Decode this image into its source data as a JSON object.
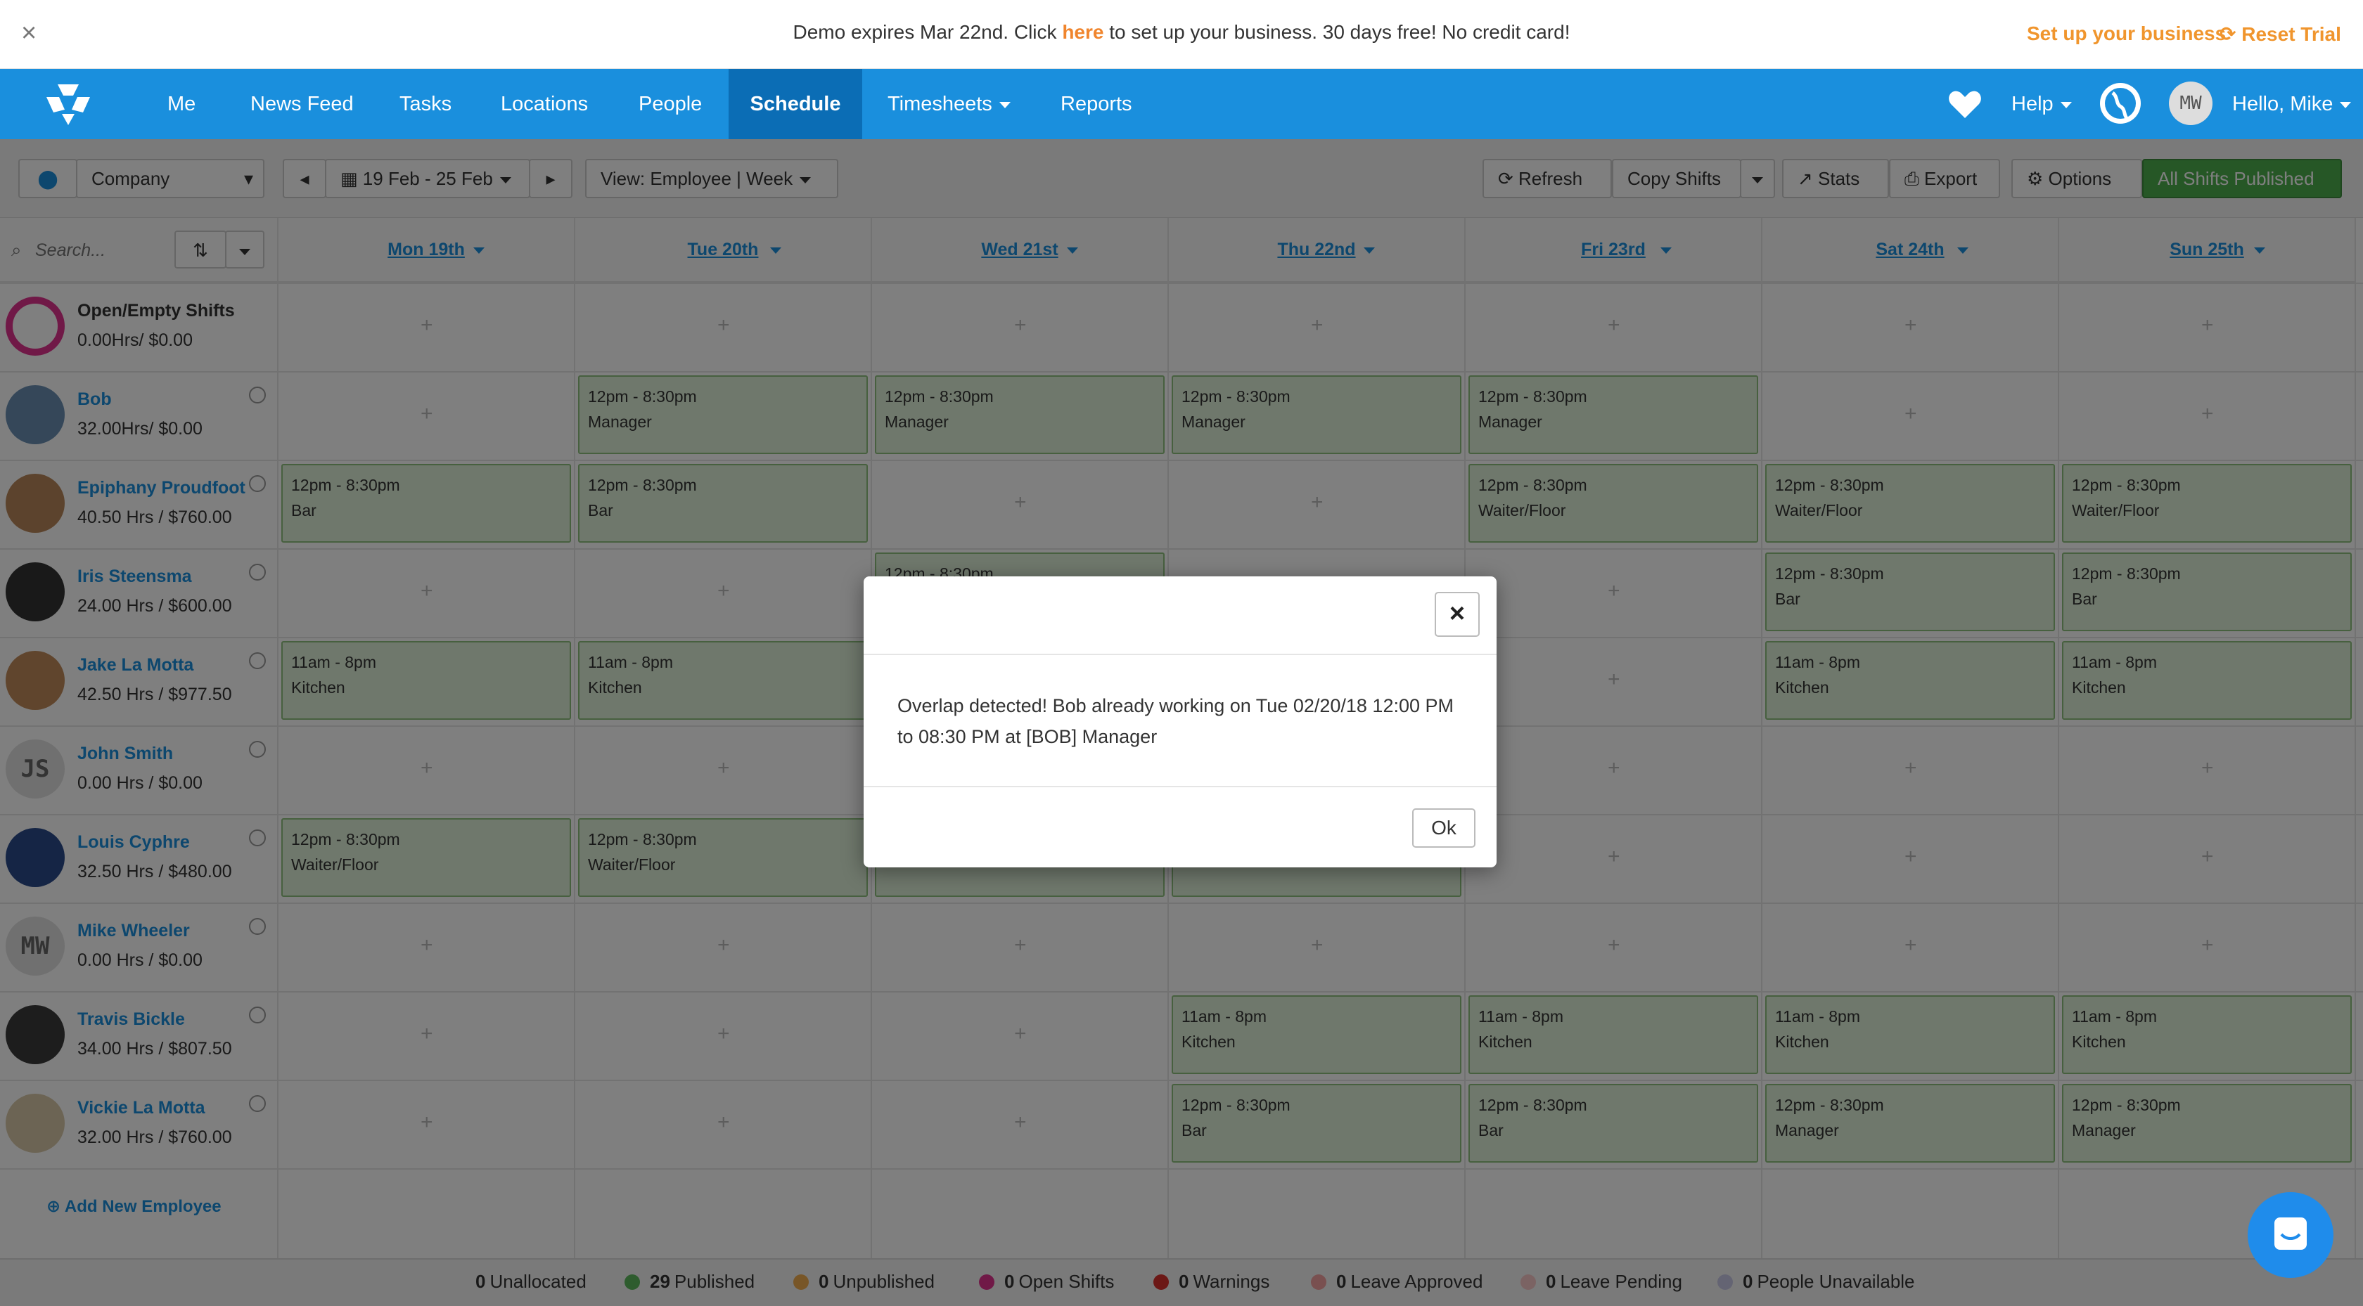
{
  "banner": {
    "close": "×",
    "pre": "Demo expires Mar 22nd. Click ",
    "link": "here",
    "post": " to set up your business. 30 days free! No credit card!",
    "setup": "Set up your business",
    "reset": "Reset Trial"
  },
  "nav": {
    "items": [
      "Me",
      "News Feed",
      "Tasks",
      "Locations",
      "People",
      "Schedule",
      "Timesheets",
      "Reports"
    ],
    "help": "Help",
    "user_initials": "MW",
    "user_greeting": "Hello, Mike"
  },
  "toolbar": {
    "location": "Company",
    "date_range": "19 Feb - 25 Feb",
    "view": "View:  Employee | Week",
    "refresh": "Refresh",
    "copy_shifts": "Copy Shifts",
    "stats": "Stats",
    "export": "Export",
    "options": "Options",
    "publish": "All Shifts Published",
    "search_placeholder": "Search..."
  },
  "days": [
    "Mon 19th",
    "Tue 20th",
    "Wed 21st",
    "Thu 22nd",
    "Fri 23rd",
    "Sat 24th",
    "Sun 25th"
  ],
  "employees": [
    {
      "name": "Open/Empty Shifts",
      "hours": "0.00Hrs/ $0.00",
      "initials": ""
    },
    {
      "name": "Bob",
      "hours": "32.00Hrs/ $0.00",
      "initials": ""
    },
    {
      "name": "Epiphany Proudfoot",
      "hours": "40.50 Hrs / $760.00",
      "initials": ""
    },
    {
      "name": "Iris Steensma",
      "hours": "24.00 Hrs / $600.00",
      "initials": ""
    },
    {
      "name": "Jake La Motta",
      "hours": "42.50 Hrs / $977.50",
      "initials": ""
    },
    {
      "name": "John Smith",
      "hours": "0.00 Hrs / $0.00",
      "initials": "JS"
    },
    {
      "name": "Louis Cyphre",
      "hours": "32.50 Hrs / $480.00",
      "initials": ""
    },
    {
      "name": "Mike Wheeler",
      "hours": "0.00 Hrs / $0.00",
      "initials": "MW"
    },
    {
      "name": "Travis Bickle",
      "hours": "34.00 Hrs / $807.50",
      "initials": ""
    },
    {
      "name": "Vickie La Motta",
      "hours": "32.00 Hrs / $760.00",
      "initials": ""
    }
  ],
  "shifts": [
    {
      "row": 1,
      "day": 1,
      "time": "12pm - 8:30pm",
      "role": "Manager"
    },
    {
      "row": 1,
      "day": 2,
      "time": "12pm - 8:30pm",
      "role": "Manager"
    },
    {
      "row": 1,
      "day": 3,
      "time": "12pm - 8:30pm",
      "role": "Manager"
    },
    {
      "row": 1,
      "day": 4,
      "time": "12pm - 8:30pm",
      "role": "Manager"
    },
    {
      "row": 2,
      "day": 0,
      "time": "12pm - 8:30pm",
      "role": "Bar"
    },
    {
      "row": 2,
      "day": 1,
      "time": "12pm - 8:30pm",
      "role": "Bar"
    },
    {
      "row": 2,
      "day": 4,
      "time": "12pm - 8:30pm",
      "role": "Waiter/Floor"
    },
    {
      "row": 2,
      "day": 5,
      "time": "12pm - 8:30pm",
      "role": "Waiter/Floor"
    },
    {
      "row": 2,
      "day": 6,
      "time": "12pm - 8:30pm",
      "role": "Waiter/Floor"
    },
    {
      "row": 3,
      "day": 2,
      "time": "12pm - 8:30pm",
      "role": ""
    },
    {
      "row": 3,
      "day": 5,
      "time": "12pm - 8:30pm",
      "role": "Bar"
    },
    {
      "row": 3,
      "day": 6,
      "time": "12pm - 8:30pm",
      "role": "Bar"
    },
    {
      "row": 4,
      "day": 0,
      "time": "11am - 8pm",
      "role": "Kitchen"
    },
    {
      "row": 4,
      "day": 1,
      "time": "11am - 8pm",
      "role": "Kitchen"
    },
    {
      "row": 4,
      "day": 2,
      "time": "",
      "role": ""
    },
    {
      "row": 4,
      "day": 5,
      "time": "11am - 8pm",
      "role": "Kitchen"
    },
    {
      "row": 4,
      "day": 6,
      "time": "11am - 8pm",
      "role": "Kitchen"
    },
    {
      "row": 6,
      "day": 0,
      "time": "12pm - 8:30pm",
      "role": "Waiter/Floor"
    },
    {
      "row": 6,
      "day": 1,
      "time": "12pm - 8:30pm",
      "role": "Waiter/Floor"
    },
    {
      "row": 6,
      "day": 2,
      "time": "",
      "role": ""
    },
    {
      "row": 6,
      "day": 3,
      "time": "",
      "role": ""
    },
    {
      "row": 8,
      "day": 3,
      "time": "11am - 8pm",
      "role": "Kitchen"
    },
    {
      "row": 8,
      "day": 4,
      "time": "11am - 8pm",
      "role": "Kitchen"
    },
    {
      "row": 8,
      "day": 5,
      "time": "11am - 8pm",
      "role": "Kitchen"
    },
    {
      "row": 8,
      "day": 6,
      "time": "11am - 8pm",
      "role": "Kitchen"
    },
    {
      "row": 9,
      "day": 3,
      "time": "12pm - 8:30pm",
      "role": "Bar"
    },
    {
      "row": 9,
      "day": 4,
      "time": "12pm - 8:30pm",
      "role": "Bar"
    },
    {
      "row": 9,
      "day": 5,
      "time": "12pm - 8:30pm",
      "role": "Manager"
    },
    {
      "row": 9,
      "day": 6,
      "time": "12pm - 8:30pm",
      "role": "Manager"
    }
  ],
  "add_employee": "Add New Employee",
  "legend": [
    {
      "count": "0",
      "label": "Unallocated",
      "color": ""
    },
    {
      "count": "29",
      "label": "Published",
      "color": "#5cb85c"
    },
    {
      "count": "0",
      "label": "Unpublished",
      "color": "#f0ad4e"
    },
    {
      "count": "0",
      "label": "Open Shifts",
      "color": "#e0338f"
    },
    {
      "count": "0",
      "label": "Warnings",
      "color": "#d9302c"
    },
    {
      "count": "0",
      "label": "Leave Approved",
      "color": "#f2a0a0"
    },
    {
      "count": "0",
      "label": "Leave Pending",
      "color": "#f7c6c6"
    },
    {
      "count": "0",
      "label": "People Unavailable",
      "color": "#c9c9e6"
    }
  ],
  "modal": {
    "close": "×",
    "message": "Overlap detected! Bob already working on Tue 02/20/18 12:00 PM to 08:30 PM at [BOB] Manager",
    "ok": "Ok"
  },
  "colors": {
    "nav": "#1a8fdd",
    "nav_active": "#0b6db5",
    "accent": "#f0852d",
    "shift_bg": "#dff0d8",
    "shift_border": "#8fc07e"
  }
}
